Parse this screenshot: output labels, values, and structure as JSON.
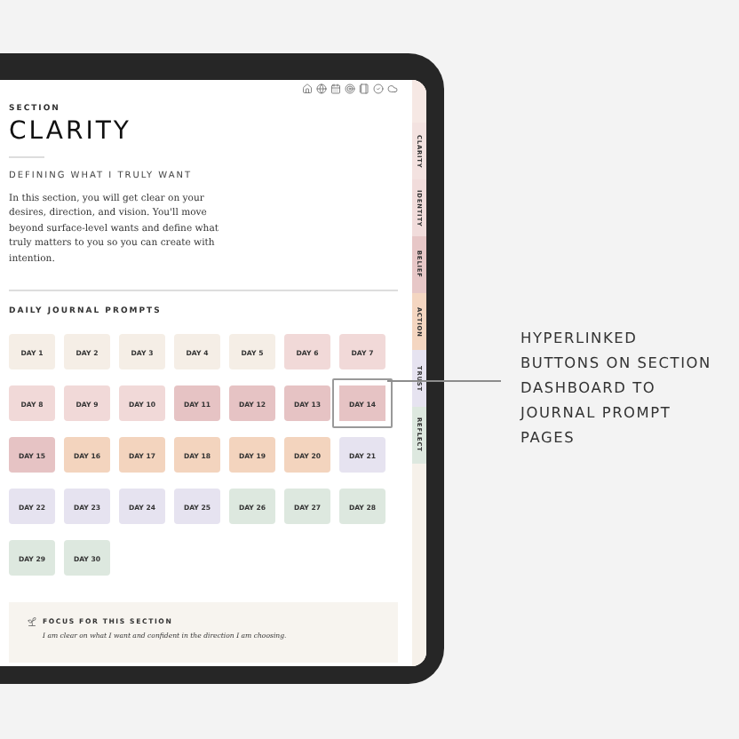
{
  "section_label": "SECTION",
  "title": "CLARITY",
  "subtitle": "DEFINING WHAT I TRULY WANT",
  "intro": "In this section, you will get clear on your desires, direction, and vision. You'll move beyond surface-level wants and define what truly matters to you so you can create with intention.",
  "prompts_heading": "DAILY JOURNAL PROMPTS",
  "days": [
    {
      "label": "DAY 1",
      "color": "#f5eee6",
      "selected": false
    },
    {
      "label": "DAY 2",
      "color": "#f5eee6",
      "selected": false
    },
    {
      "label": "DAY 3",
      "color": "#f5eee6",
      "selected": false
    },
    {
      "label": "DAY 4",
      "color": "#f5eee6",
      "selected": false
    },
    {
      "label": "DAY 5",
      "color": "#f5eee6",
      "selected": false
    },
    {
      "label": "DAY 6",
      "color": "#f1d9d8",
      "selected": false
    },
    {
      "label": "DAY 7",
      "color": "#f1d9d8",
      "selected": false
    },
    {
      "label": "DAY 8",
      "color": "#f1d9d8",
      "selected": false
    },
    {
      "label": "DAY 9",
      "color": "#f1d9d8",
      "selected": false
    },
    {
      "label": "DAY 10",
      "color": "#f1d9d8",
      "selected": false
    },
    {
      "label": "DAY 11",
      "color": "#e6c3c4",
      "selected": false
    },
    {
      "label": "DAY 12",
      "color": "#e6c3c4",
      "selected": false
    },
    {
      "label": "DAY 13",
      "color": "#e6c3c4",
      "selected": false
    },
    {
      "label": "DAY 14",
      "color": "#e6c3c4",
      "selected": true
    },
    {
      "label": "DAY 15",
      "color": "#e6c3c4",
      "selected": false
    },
    {
      "label": "DAY 16",
      "color": "#f3d4be",
      "selected": false
    },
    {
      "label": "DAY 17",
      "color": "#f3d4be",
      "selected": false
    },
    {
      "label": "DAY 18",
      "color": "#f3d4be",
      "selected": false
    },
    {
      "label": "DAY 19",
      "color": "#f3d4be",
      "selected": false
    },
    {
      "label": "DAY 20",
      "color": "#f3d4be",
      "selected": false
    },
    {
      "label": "DAY 21",
      "color": "#e6e3f0",
      "selected": false
    },
    {
      "label": "DAY 22",
      "color": "#e6e3f0",
      "selected": false
    },
    {
      "label": "DAY 23",
      "color": "#e6e3f0",
      "selected": false
    },
    {
      "label": "DAY 24",
      "color": "#e6e3f0",
      "selected": false
    },
    {
      "label": "DAY 25",
      "color": "#e6e3f0",
      "selected": false
    },
    {
      "label": "DAY 26",
      "color": "#dde8df",
      "selected": false
    },
    {
      "label": "DAY 27",
      "color": "#dde8df",
      "selected": false
    },
    {
      "label": "DAY 28",
      "color": "#dde8df",
      "selected": false
    },
    {
      "label": "DAY 29",
      "color": "#dde8df",
      "selected": false
    },
    {
      "label": "DAY 30",
      "color": "#dde8df",
      "selected": false
    }
  ],
  "focus": {
    "heading": "FOCUS FOR THIS SECTION",
    "text": "I am clear on what I want and confident in the direction I am choosing."
  },
  "side_tabs": [
    {
      "label": "CLARITY",
      "color": "#f3e2e0"
    },
    {
      "label": "IDENTITY",
      "color": "#f1dcdb"
    },
    {
      "label": "BELIEF",
      "color": "#e7c7c7"
    },
    {
      "label": "ACTION",
      "color": "#f4d6c1"
    },
    {
      "label": "TRUST",
      "color": "#e6e3f0"
    },
    {
      "label": "REFLECT",
      "color": "#dde8df"
    }
  ],
  "annotation": "HYPERLINKED BUTTONS ON SECTION DASHBOARD TO JOURNAL PROMPT PAGES"
}
